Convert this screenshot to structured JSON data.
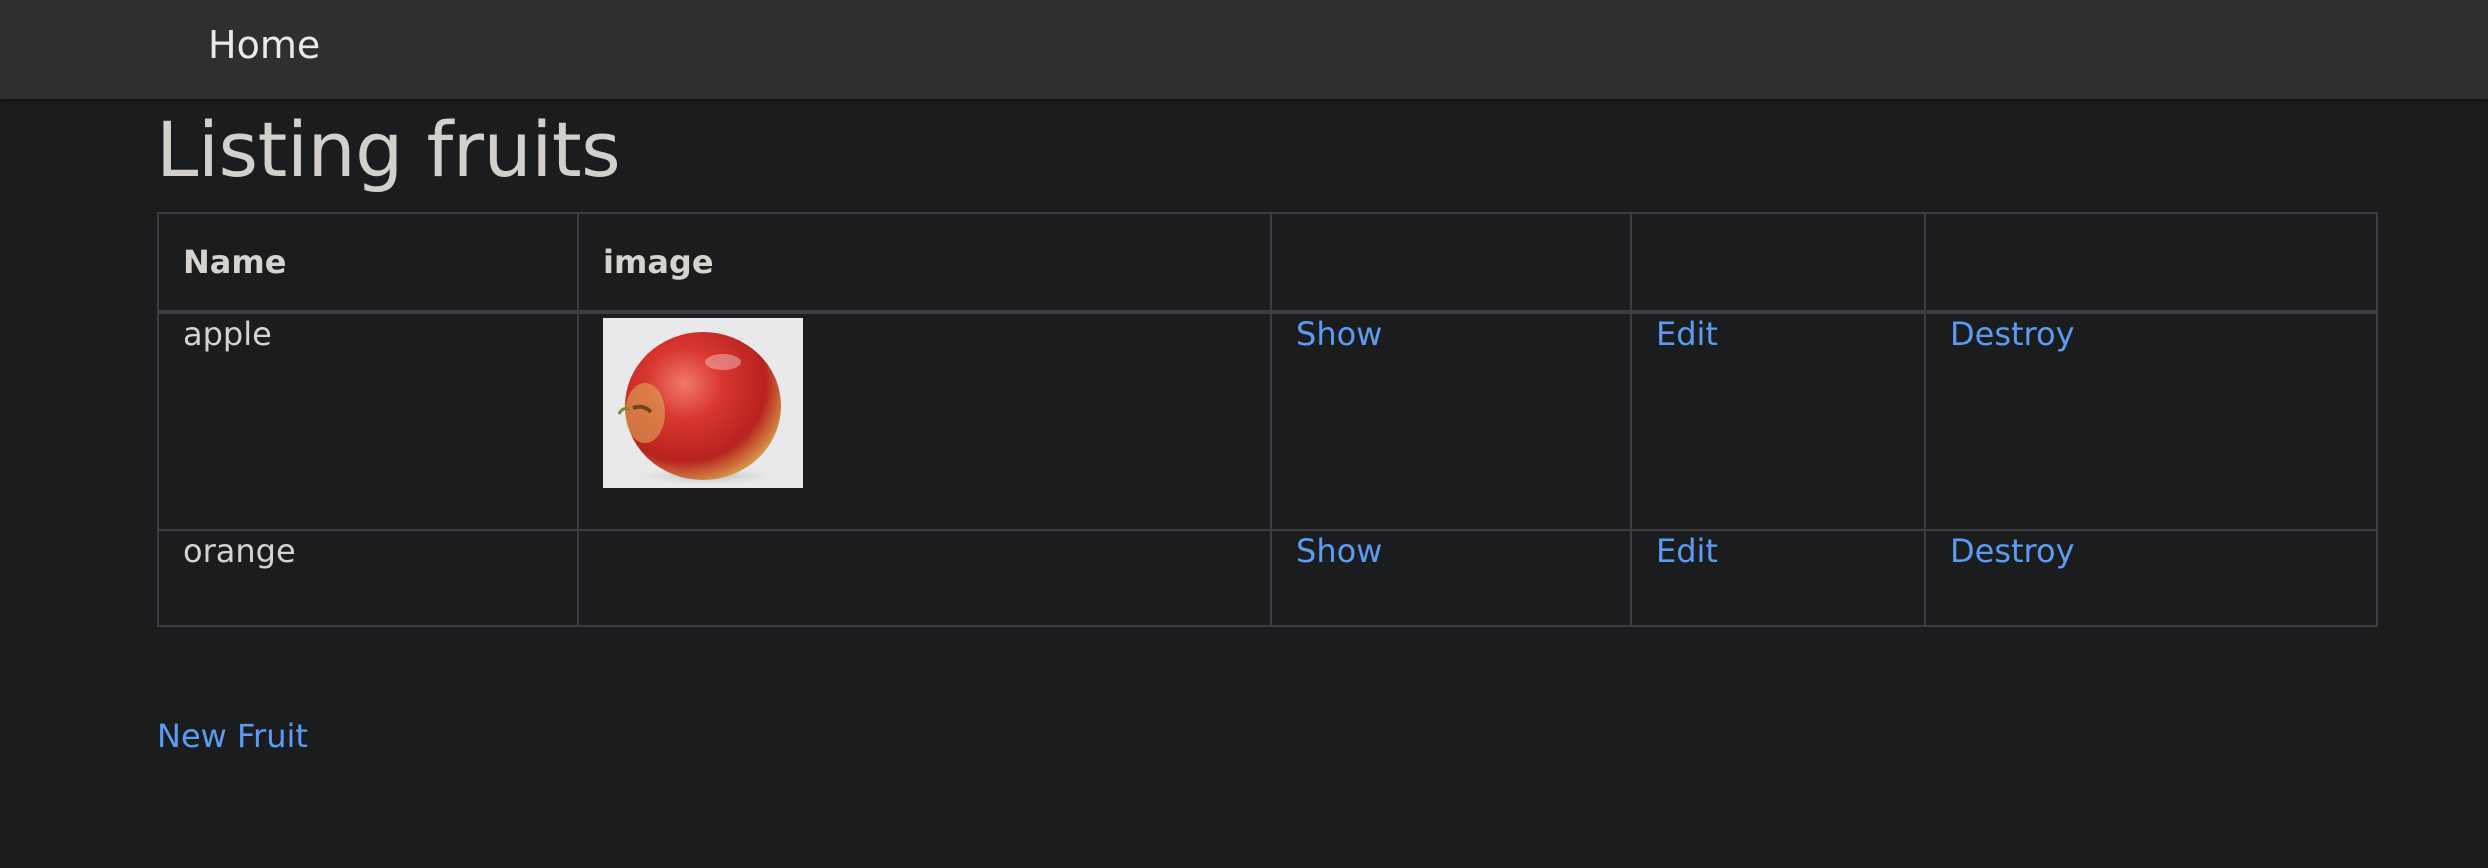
{
  "nav": {
    "home_label": "Home"
  },
  "page": {
    "title": "Listing fruits"
  },
  "table": {
    "headers": [
      "Name",
      "image",
      "",
      "",
      ""
    ],
    "rows": [
      {
        "name": "apple",
        "has_image": true,
        "image_alt": "apple",
        "show": "Show",
        "edit": "Edit",
        "destroy": "Destroy"
      },
      {
        "name": "orange",
        "has_image": false,
        "show": "Show",
        "edit": "Edit",
        "destroy": "Destroy"
      }
    ]
  },
  "actions": {
    "new_fruit": "New Fruit"
  },
  "colors": {
    "background": "#1b1c1e",
    "navbar": "#2e2f31",
    "link": "#5b9cf2",
    "text": "#d6d3ce"
  }
}
